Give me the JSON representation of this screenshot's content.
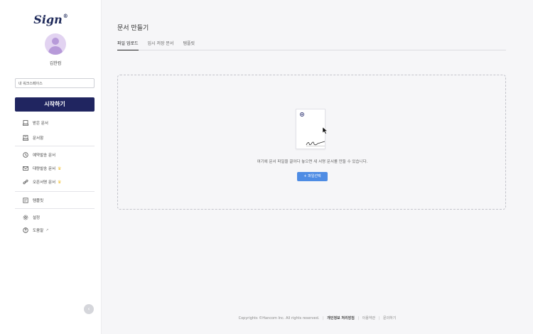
{
  "brand": {
    "logo": "Sign",
    "logo_mark": "®"
  },
  "user": {
    "name": "김한컴"
  },
  "workspace": {
    "label": "내 워크스페이스"
  },
  "start_button": {
    "label": "시작하기"
  },
  "nav": {
    "received": "받은 문서",
    "archive": "문서함",
    "scheduled": "예약발송 문서",
    "bulk": "대량발송 문서",
    "open_sign": "오픈서명 문서",
    "templates": "템플릿",
    "settings": "설정",
    "help": "도움말"
  },
  "page": {
    "title": "문서 만들기"
  },
  "tabs": [
    {
      "label": "파일 업로드",
      "active": true
    },
    {
      "label": "임시 저장 문서",
      "active": false
    },
    {
      "label": "템플릿",
      "active": false
    }
  ],
  "dropzone": {
    "hint": "여기에 문서 파일을 끌어다 놓으면 새 서명 문서를 만들 수 있습니다.",
    "button_label": "+ 파일선택"
  },
  "footer": {
    "copyright": "Copyrights ©Hancom Inc. All rights reserved.",
    "privacy": "개인정보 처리방침",
    "terms": "이용약관",
    "contact": "문의하기"
  },
  "colors": {
    "primary": "#202560",
    "accent": "#4e8ce4",
    "premium": "#f2c23a"
  },
  "icons": {
    "received": "inbox-icon",
    "archive": "archive-icon",
    "scheduled": "clock-icon",
    "bulk": "bulk-mail-icon",
    "open_sign": "link-icon",
    "templates": "template-icon",
    "settings": "gear-icon",
    "help": "help-icon",
    "collapse": "chevron-left-icon"
  }
}
